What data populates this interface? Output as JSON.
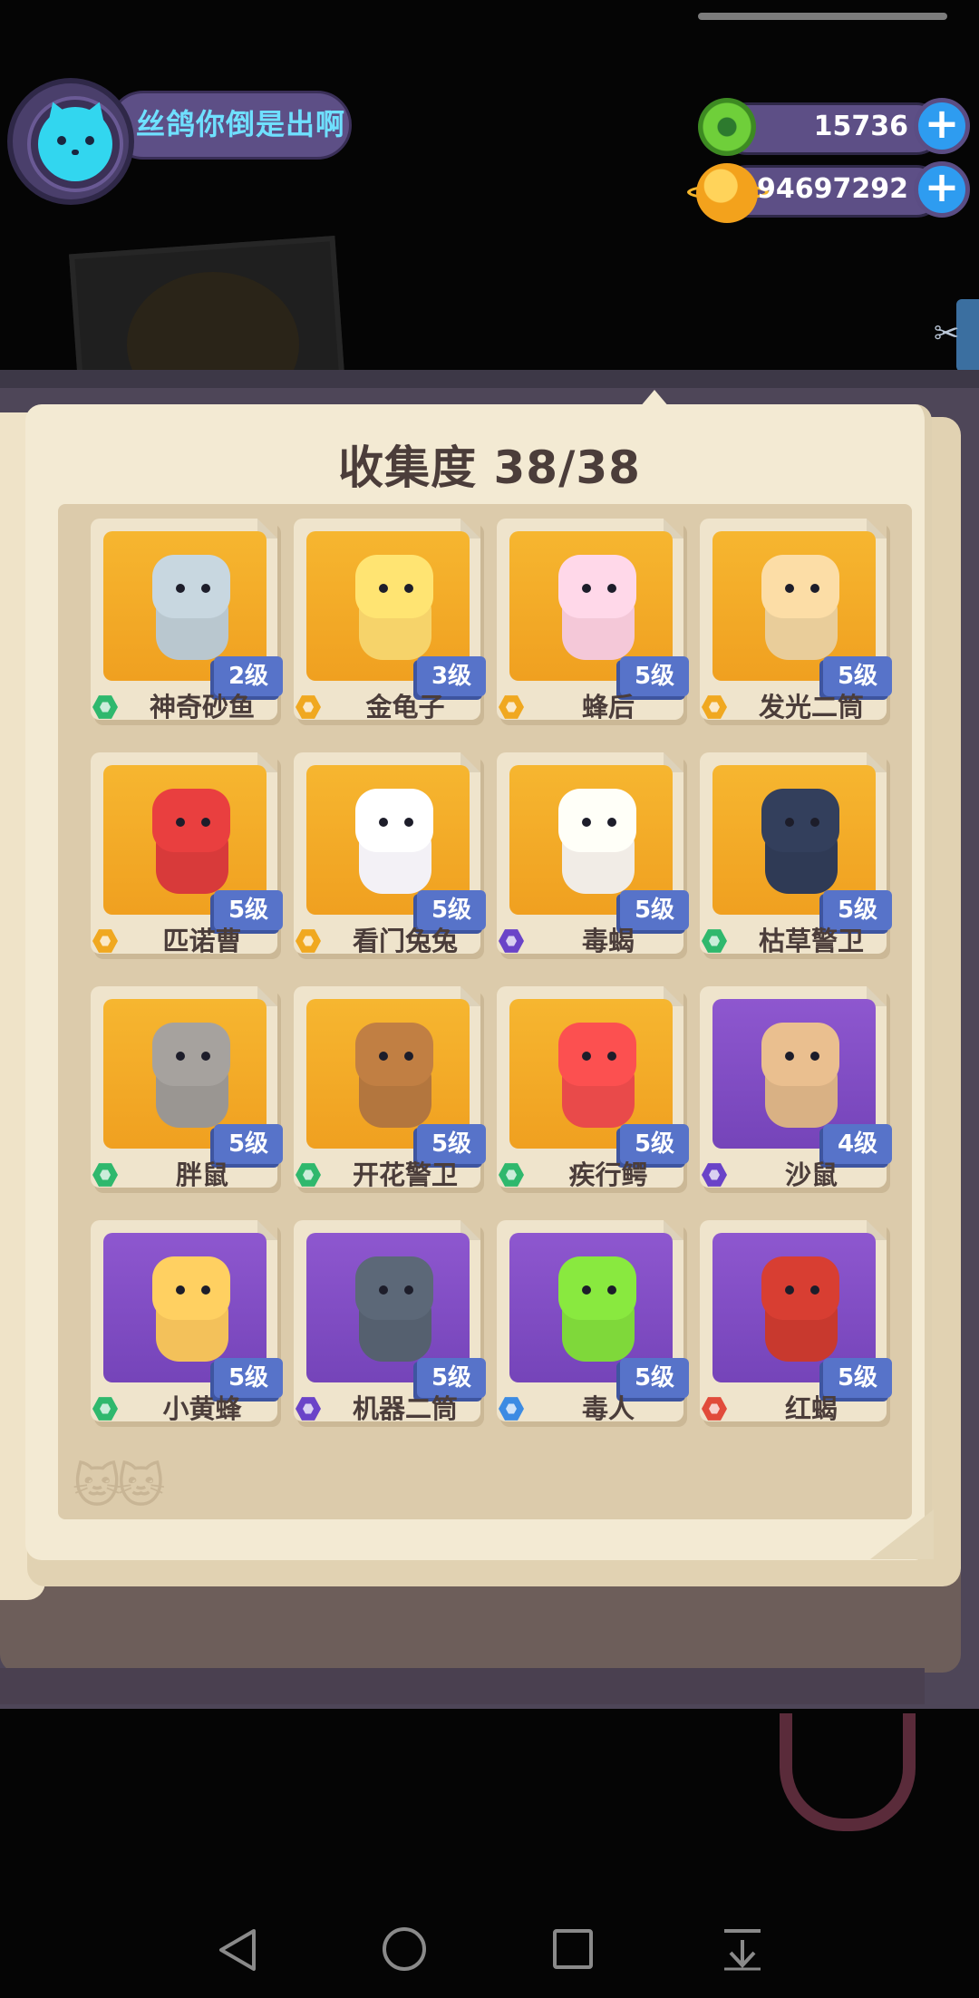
{
  "user": {
    "name": "丝鸽你倒是出啊"
  },
  "currency": {
    "gems": "15736",
    "coins": "94697292"
  },
  "colors": {
    "rarity_green": "#2fb86d",
    "rarity_gold": "#f0a820",
    "rarity_purple": "#6a43c8",
    "rarity_blue": "#3c8be3",
    "rarity_red": "#e14b3b",
    "card_orange": "#f4ac28",
    "card_purple": "#7e4cc4",
    "level_badge": "#5773c9"
  },
  "collection": {
    "title": "收集度 38/38",
    "cards": [
      {
        "name": "神奇砂鱼",
        "level": "2级",
        "rarity": "green",
        "bg": "orange",
        "color": "#b9c7cf"
      },
      {
        "name": "金龟子",
        "level": "3级",
        "rarity": "gold",
        "bg": "orange",
        "color": "#f6d36a"
      },
      {
        "name": "蜂后",
        "level": "5级",
        "rarity": "gold",
        "bg": "orange",
        "color": "#f4c8d8"
      },
      {
        "name": "发光二筒",
        "level": "5级",
        "rarity": "gold",
        "bg": "orange",
        "color": "#e9cd9a"
      },
      {
        "name": "匹诺曹",
        "level": "5级",
        "rarity": "gold",
        "bg": "orange",
        "color": "#d83a3a"
      },
      {
        "name": "看门兔兔",
        "level": "5级",
        "rarity": "gold",
        "bg": "orange",
        "color": "#f3f1f6"
      },
      {
        "name": "毒蝎",
        "level": "5级",
        "rarity": "purple",
        "bg": "orange",
        "color": "#f1ece6"
      },
      {
        "name": "枯草警卫",
        "level": "5级",
        "rarity": "green",
        "bg": "orange",
        "color": "#2f3a55"
      },
      {
        "name": "胖鼠",
        "level": "5级",
        "rarity": "green",
        "bg": "orange",
        "color": "#9a9692"
      },
      {
        "name": "开花警卫",
        "level": "5级",
        "rarity": "green",
        "bg": "orange",
        "color": "#b3763e"
      },
      {
        "name": "疾行鳄",
        "level": "5级",
        "rarity": "green",
        "bg": "orange",
        "color": "#e94a4a"
      },
      {
        "name": "沙鼠",
        "level": "4级",
        "rarity": "purple",
        "bg": "purple",
        "color": "#d9b184"
      },
      {
        "name": "小黄蜂",
        "level": "5级",
        "rarity": "green",
        "bg": "purple",
        "color": "#f3c15a"
      },
      {
        "name": "机器二筒",
        "level": "5级",
        "rarity": "purple",
        "bg": "purple",
        "color": "#55606f"
      },
      {
        "name": "毒人",
        "level": "5级",
        "rarity": "blue",
        "bg": "purple",
        "color": "#7fd83a"
      },
      {
        "name": "红蝎",
        "level": "5级",
        "rarity": "red",
        "bg": "purple",
        "color": "#c8392e"
      }
    ]
  },
  "icons": {
    "avatar": "cat-avatar-icon",
    "gems": "donut-gem-icon",
    "coins": "planet-coin-icon",
    "add": "plus-icon",
    "side": "scissors-icon",
    "nav": [
      "back-triangle-icon",
      "home-circle-icon",
      "recents-square-icon",
      "notification-down-icon"
    ]
  }
}
